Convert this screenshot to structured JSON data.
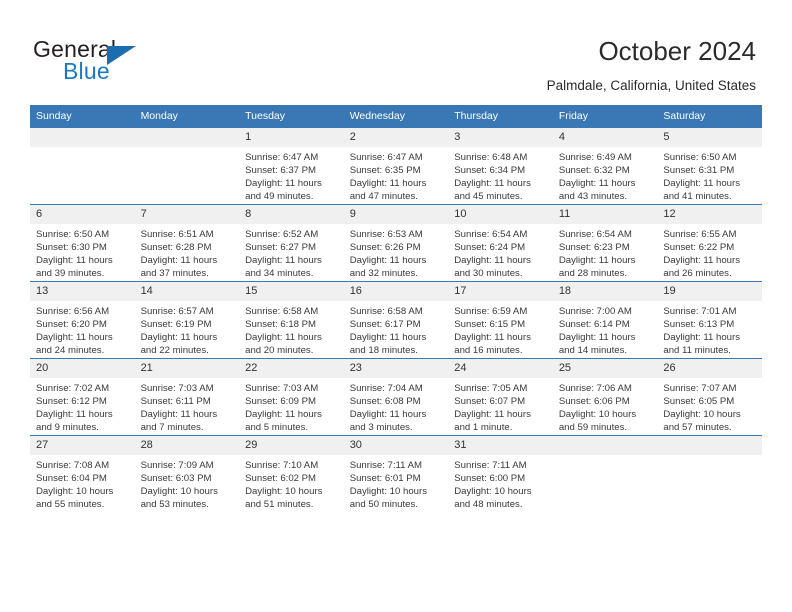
{
  "brand": {
    "logo_text_primary": "General",
    "logo_text_secondary": "Blue",
    "logo_icon": "triangle-icon",
    "primary_color": "#1b6cb0",
    "accent_color": "#3a78b5"
  },
  "header": {
    "title": "October 2024",
    "subtitle": "Palmdale, California, United States"
  },
  "calendar": {
    "weekday_headers": [
      "Sunday",
      "Monday",
      "Tuesday",
      "Wednesday",
      "Thursday",
      "Friday",
      "Saturday"
    ],
    "header_bg": "#3a78b5",
    "daynum_bg": "#f0f0f0",
    "labels": {
      "sunrise": "Sunrise:",
      "sunset": "Sunset:",
      "daylight": "Daylight:"
    },
    "weeks": [
      [
        {
          "day": "",
          "empty": true
        },
        {
          "day": "",
          "empty": true
        },
        {
          "day": "1",
          "sunrise": "Sunrise: 6:47 AM",
          "sunset": "Sunset: 6:37 PM",
          "daylight_line1": "Daylight: 11 hours",
          "daylight_line2": "and 49 minutes."
        },
        {
          "day": "2",
          "sunrise": "Sunrise: 6:47 AM",
          "sunset": "Sunset: 6:35 PM",
          "daylight_line1": "Daylight: 11 hours",
          "daylight_line2": "and 47 minutes."
        },
        {
          "day": "3",
          "sunrise": "Sunrise: 6:48 AM",
          "sunset": "Sunset: 6:34 PM",
          "daylight_line1": "Daylight: 11 hours",
          "daylight_line2": "and 45 minutes."
        },
        {
          "day": "4",
          "sunrise": "Sunrise: 6:49 AM",
          "sunset": "Sunset: 6:32 PM",
          "daylight_line1": "Daylight: 11 hours",
          "daylight_line2": "and 43 minutes."
        },
        {
          "day": "5",
          "sunrise": "Sunrise: 6:50 AM",
          "sunset": "Sunset: 6:31 PM",
          "daylight_line1": "Daylight: 11 hours",
          "daylight_line2": "and 41 minutes."
        }
      ],
      [
        {
          "day": "6",
          "sunrise": "Sunrise: 6:50 AM",
          "sunset": "Sunset: 6:30 PM",
          "daylight_line1": "Daylight: 11 hours",
          "daylight_line2": "and 39 minutes."
        },
        {
          "day": "7",
          "sunrise": "Sunrise: 6:51 AM",
          "sunset": "Sunset: 6:28 PM",
          "daylight_line1": "Daylight: 11 hours",
          "daylight_line2": "and 37 minutes."
        },
        {
          "day": "8",
          "sunrise": "Sunrise: 6:52 AM",
          "sunset": "Sunset: 6:27 PM",
          "daylight_line1": "Daylight: 11 hours",
          "daylight_line2": "and 34 minutes."
        },
        {
          "day": "9",
          "sunrise": "Sunrise: 6:53 AM",
          "sunset": "Sunset: 6:26 PM",
          "daylight_line1": "Daylight: 11 hours",
          "daylight_line2": "and 32 minutes."
        },
        {
          "day": "10",
          "sunrise": "Sunrise: 6:54 AM",
          "sunset": "Sunset: 6:24 PM",
          "daylight_line1": "Daylight: 11 hours",
          "daylight_line2": "and 30 minutes."
        },
        {
          "day": "11",
          "sunrise": "Sunrise: 6:54 AM",
          "sunset": "Sunset: 6:23 PM",
          "daylight_line1": "Daylight: 11 hours",
          "daylight_line2": "and 28 minutes."
        },
        {
          "day": "12",
          "sunrise": "Sunrise: 6:55 AM",
          "sunset": "Sunset: 6:22 PM",
          "daylight_line1": "Daylight: 11 hours",
          "daylight_line2": "and 26 minutes."
        }
      ],
      [
        {
          "day": "13",
          "sunrise": "Sunrise: 6:56 AM",
          "sunset": "Sunset: 6:20 PM",
          "daylight_line1": "Daylight: 11 hours",
          "daylight_line2": "and 24 minutes."
        },
        {
          "day": "14",
          "sunrise": "Sunrise: 6:57 AM",
          "sunset": "Sunset: 6:19 PM",
          "daylight_line1": "Daylight: 11 hours",
          "daylight_line2": "and 22 minutes."
        },
        {
          "day": "15",
          "sunrise": "Sunrise: 6:58 AM",
          "sunset": "Sunset: 6:18 PM",
          "daylight_line1": "Daylight: 11 hours",
          "daylight_line2": "and 20 minutes."
        },
        {
          "day": "16",
          "sunrise": "Sunrise: 6:58 AM",
          "sunset": "Sunset: 6:17 PM",
          "daylight_line1": "Daylight: 11 hours",
          "daylight_line2": "and 18 minutes."
        },
        {
          "day": "17",
          "sunrise": "Sunrise: 6:59 AM",
          "sunset": "Sunset: 6:15 PM",
          "daylight_line1": "Daylight: 11 hours",
          "daylight_line2": "and 16 minutes."
        },
        {
          "day": "18",
          "sunrise": "Sunrise: 7:00 AM",
          "sunset": "Sunset: 6:14 PM",
          "daylight_line1": "Daylight: 11 hours",
          "daylight_line2": "and 14 minutes."
        },
        {
          "day": "19",
          "sunrise": "Sunrise: 7:01 AM",
          "sunset": "Sunset: 6:13 PM",
          "daylight_line1": "Daylight: 11 hours",
          "daylight_line2": "and 11 minutes."
        }
      ],
      [
        {
          "day": "20",
          "sunrise": "Sunrise: 7:02 AM",
          "sunset": "Sunset: 6:12 PM",
          "daylight_line1": "Daylight: 11 hours",
          "daylight_line2": "and 9 minutes."
        },
        {
          "day": "21",
          "sunrise": "Sunrise: 7:03 AM",
          "sunset": "Sunset: 6:11 PM",
          "daylight_line1": "Daylight: 11 hours",
          "daylight_line2": "and 7 minutes."
        },
        {
          "day": "22",
          "sunrise": "Sunrise: 7:03 AM",
          "sunset": "Sunset: 6:09 PM",
          "daylight_line1": "Daylight: 11 hours",
          "daylight_line2": "and 5 minutes."
        },
        {
          "day": "23",
          "sunrise": "Sunrise: 7:04 AM",
          "sunset": "Sunset: 6:08 PM",
          "daylight_line1": "Daylight: 11 hours",
          "daylight_line2": "and 3 minutes."
        },
        {
          "day": "24",
          "sunrise": "Sunrise: 7:05 AM",
          "sunset": "Sunset: 6:07 PM",
          "daylight_line1": "Daylight: 11 hours",
          "daylight_line2": "and 1 minute."
        },
        {
          "day": "25",
          "sunrise": "Sunrise: 7:06 AM",
          "sunset": "Sunset: 6:06 PM",
          "daylight_line1": "Daylight: 10 hours",
          "daylight_line2": "and 59 minutes."
        },
        {
          "day": "26",
          "sunrise": "Sunrise: 7:07 AM",
          "sunset": "Sunset: 6:05 PM",
          "daylight_line1": "Daylight: 10 hours",
          "daylight_line2": "and 57 minutes."
        }
      ],
      [
        {
          "day": "27",
          "sunrise": "Sunrise: 7:08 AM",
          "sunset": "Sunset: 6:04 PM",
          "daylight_line1": "Daylight: 10 hours",
          "daylight_line2": "and 55 minutes."
        },
        {
          "day": "28",
          "sunrise": "Sunrise: 7:09 AM",
          "sunset": "Sunset: 6:03 PM",
          "daylight_line1": "Daylight: 10 hours",
          "daylight_line2": "and 53 minutes."
        },
        {
          "day": "29",
          "sunrise": "Sunrise: 7:10 AM",
          "sunset": "Sunset: 6:02 PM",
          "daylight_line1": "Daylight: 10 hours",
          "daylight_line2": "and 51 minutes."
        },
        {
          "day": "30",
          "sunrise": "Sunrise: 7:11 AM",
          "sunset": "Sunset: 6:01 PM",
          "daylight_line1": "Daylight: 10 hours",
          "daylight_line2": "and 50 minutes."
        },
        {
          "day": "31",
          "sunrise": "Sunrise: 7:11 AM",
          "sunset": "Sunset: 6:00 PM",
          "daylight_line1": "Daylight: 10 hours",
          "daylight_line2": "and 48 minutes."
        },
        {
          "day": "",
          "empty": true
        },
        {
          "day": "",
          "empty": true
        }
      ]
    ]
  }
}
